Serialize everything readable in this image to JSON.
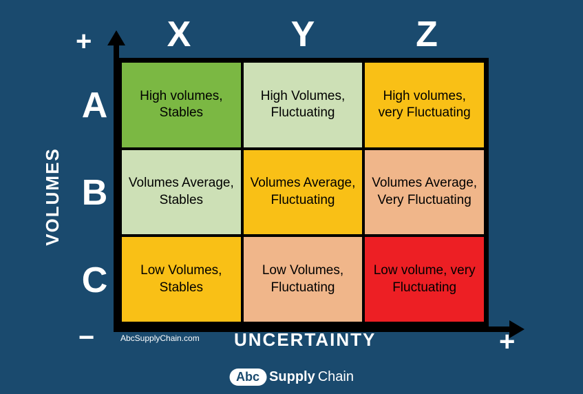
{
  "cols": {
    "x": "X",
    "y": "Y",
    "z": "Z"
  },
  "rows": {
    "a": "A",
    "b": "B",
    "c": "C"
  },
  "axis": {
    "y_label": "VOLUMES",
    "x_label": "UNCERTAINTY",
    "y_plus": "+",
    "y_minus": "−",
    "x_plus": "+"
  },
  "cells": {
    "ax": "High volumes, Stables",
    "ay": "High Volumes, Fluctuating",
    "az": "High volumes, very Fluctuating",
    "bx": "Volumes Average, Stables",
    "by": "Volumes Average, Fluctuating",
    "bz": "Volumes Average, Very Fluctuating",
    "cx": "Low Volumes, Stables",
    "cy": "Low Volumes, Fluctuating",
    "cz": "Low volume, very Fluctuating"
  },
  "attribution": "AbcSupplyChain.com",
  "logo": {
    "abc": "Abc",
    "supply": "Supply",
    "chain": "Chain"
  }
}
